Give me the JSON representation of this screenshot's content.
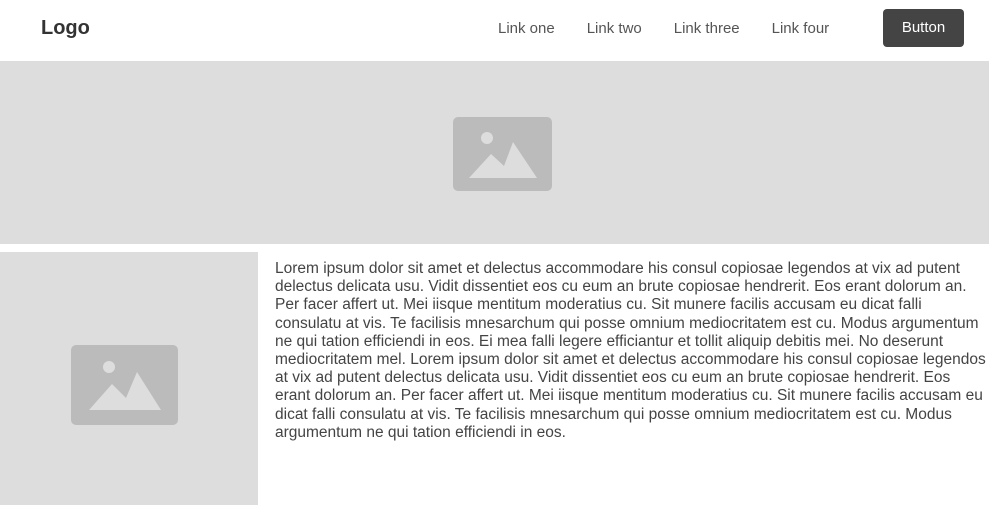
{
  "header": {
    "logo": "Logo",
    "links": [
      "Link one",
      "Link two",
      "Link three",
      "Link four"
    ],
    "button_label": "Button"
  },
  "hero": {
    "icon": "image-placeholder-icon"
  },
  "content": {
    "image_icon": "image-placeholder-icon",
    "text": "Lorem ipsum dolor sit amet et delectus accommodare his consul copiosae legendos at vix ad putent delectus delicata usu. Vidit dissentiet eos cu eum an brute copiosae hendrerit. Eos erant dolorum an. Per facer affert ut. Mei iisque mentitum moderatius cu. Sit munere facilis accusam eu dicat falli consulatu at vis. Te facilisis mnesarchum qui posse omnium mediocritatem est cu. Modus argumentum ne qui tation efficiendi in eos. Ei mea falli legere efficiantur et tollit aliquip debitis mei. No deserunt mediocritatem mel. Lorem ipsum dolor sit amet et delectus accommodare his consul copiosae legendos at vix ad putent delectus delicata usu. Vidit dissentiet eos cu eum an brute copiosae hendrerit. Eos erant dolorum an. Per facer affert ut. Mei iisque mentitum moderatius cu. Sit munere facilis accusam eu dicat falli consulatu at vis. Te facilisis mnesarchum qui posse omnium mediocritatem est cu. Modus argumentum ne qui tation efficiendi in eos."
  },
  "colors": {
    "placeholder_bg": "#dddddd",
    "placeholder_icon": "#bbbbbb",
    "button_bg": "#444444"
  }
}
